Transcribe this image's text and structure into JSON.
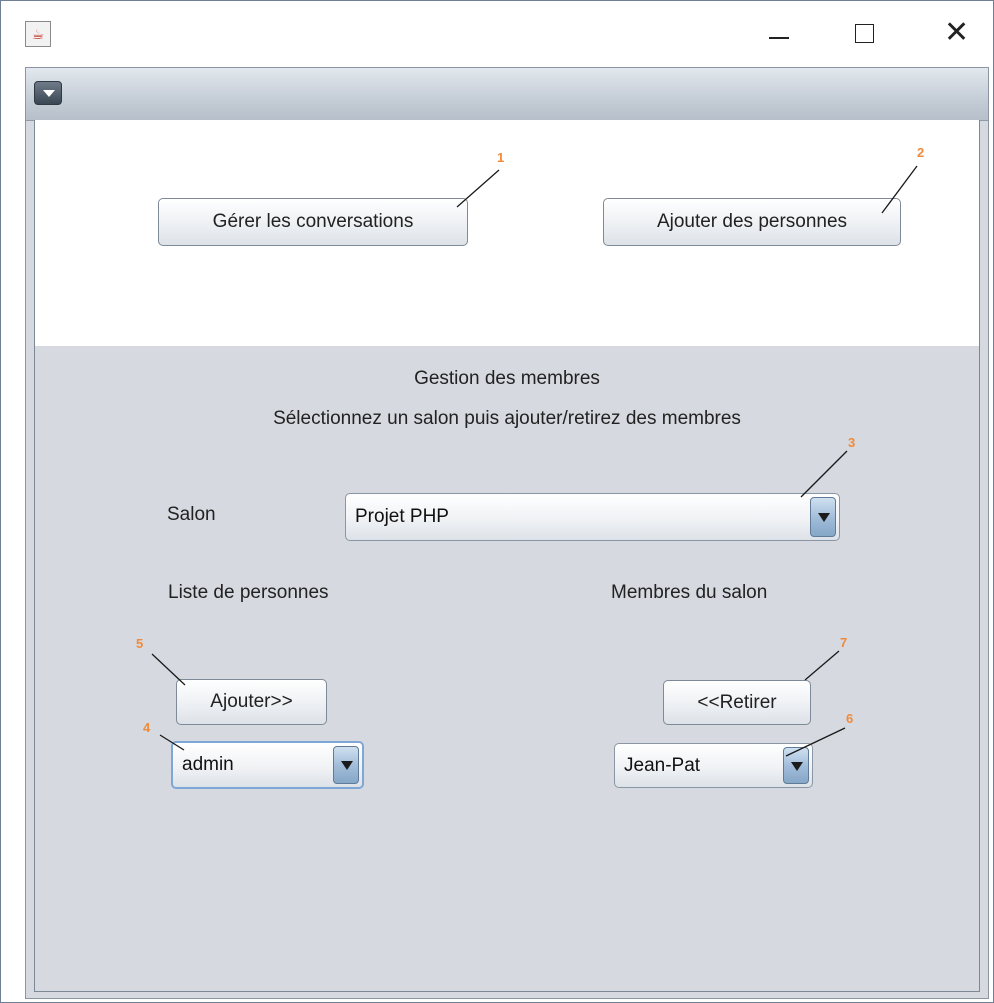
{
  "window": {
    "app_icon": "java-app-icon",
    "controls": {
      "minimize": "minimize-icon",
      "maximize": "maximize-icon",
      "close": "close-icon"
    }
  },
  "inner_frame": {
    "menu_icon": "chevron-down-icon"
  },
  "top_panel": {
    "manage_conversations_label": "Gérer les conversations",
    "add_people_label": "Ajouter des personnes"
  },
  "members_panel": {
    "title": "Gestion des membres",
    "instructions": "Sélectionnez un salon puis ajouter/retirez des membres",
    "salon_label": "Salon",
    "salon_selected": "Projet PHP",
    "people_list_label": "Liste de personnes",
    "salon_members_label": "Membres du salon",
    "add_button_label": "Ajouter>>",
    "remove_button_label": "<<Retirer",
    "people_selected": "admin",
    "members_selected": "Jean-Pat"
  },
  "callouts": [
    "1",
    "2",
    "3",
    "4",
    "5",
    "6",
    "7"
  ],
  "colors": {
    "callout": "#f08a3b",
    "panel_bg": "#d6d9df",
    "focus_border": "#7ea7d6"
  }
}
